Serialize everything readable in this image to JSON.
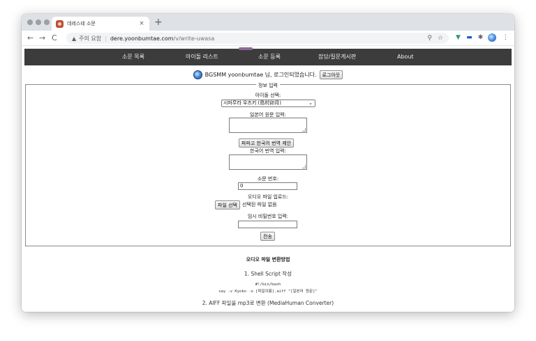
{
  "browser": {
    "tab": {
      "title": "데레스테 소문",
      "close_label": "×"
    },
    "new_tab_label": "+",
    "nav": {
      "back": "←",
      "forward": "→",
      "reload": "C"
    },
    "address": {
      "security_icon": "warning-triangle-icon",
      "security_label": "주의 요함",
      "separator": "|",
      "host": "dere.yoonbumtae.com",
      "path": "/v/write-uwasa"
    },
    "icons": [
      "zoom-icon",
      "star-icon",
      "vue-extension-icon",
      "media-extension-icon",
      "puzzle-extension-icon",
      "profile-avatar-icon",
      "menu-icon"
    ]
  },
  "nav": {
    "items": [
      {
        "label": "소문 목록"
      },
      {
        "label": "아이돌 리스트"
      },
      {
        "label": "소문 등록"
      },
      {
        "label": "잡담/질문게시판"
      },
      {
        "label": "About"
      }
    ]
  },
  "login": {
    "text": "BGSMM yoonbumtae 님, 로그인되었습니다.",
    "logout_label": "로그아웃"
  },
  "form": {
    "legend": "정보 입력",
    "idol_label": "아이돌 선택:",
    "idol_selected": "시마무라 우즈키 (島村卯月)",
    "jp_label": "일본어 원문 입력:",
    "translate_button": "파파고 한국어 번역 제안",
    "kr_label": "한국어 번역 입력:",
    "number_label": "소문 번호:",
    "number_value": "0",
    "audio_label": "오디오 파일 업로드:",
    "file_button": "파일 선택",
    "file_status": "선택된 파일 없음",
    "password_label": "임시 비밀번호 입력:",
    "submit_label": "전송"
  },
  "guide": {
    "title": "오디오 파일 변환방법",
    "step1": "1. Shell Script 작성",
    "code_line1": "#!/bin/bash",
    "code_line2": "say -v Kyoko -o [파일이름].aiff \"[일본어 원문]\"",
    "step2": "2. AIFF 파일을 mp3로 변환 (MediaHuman Converter)"
  }
}
